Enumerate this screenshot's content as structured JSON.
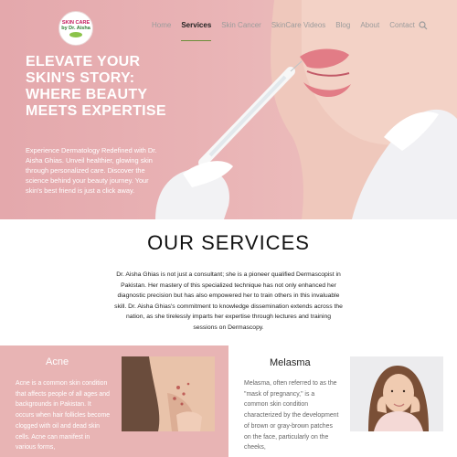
{
  "logo": {
    "line1": "SKIN CARE",
    "line2": "by Dr. Aisha",
    "line3": ""
  },
  "nav": {
    "items": [
      "Home",
      "Services",
      "Skin Cancer",
      "SkinCare Videos",
      "Blog",
      "About",
      "Contact"
    ],
    "active": "Services",
    "search_icon": "search-icon"
  },
  "hero": {
    "title": "ELEVATE YOUR SKIN'S STORY: WHERE BEAUTY MEETS EXPERTISE",
    "text": "Experience Dermatology Redefined with Dr. Aisha Ghias. Unveil healthier, glowing skin through personalized care. Discover the science behind your beauty journey. Your skin's best friend is just a click away."
  },
  "services": {
    "title": "OUR SERVICES",
    "text": "Dr. Aisha Ghias is not just a consultant; she is a pioneer qualified Dermascopist in Pakistan. Her mastery of this specialized technique has not only enhanced her diagnostic precision but has also empowered her to train others in this invaluable skill. Dr. Aisha Ghias's commitment to knowledge dissemination extends across the nation, as she tirelessly imparts her expertise through lectures and training sessions on Dermascopy."
  },
  "cards": {
    "acne": {
      "title": "Acne",
      "text": "Acne is a common skin condition that affects people of all ages and backgrounds in Pakistan. It occurs when hair follicles become clogged with oil and dead skin cells. Acne can manifest in various forms,"
    },
    "melasma": {
      "title": "Melasma",
      "text": "Melasma, often referred to as the \"mask of pregnancy,\" is a common skin condition characterized by the development of brown or gray-brown patches on the face, particularly on the cheeks,"
    }
  },
  "colors": {
    "hero_pink": "#e4a8ac",
    "card_pink": "#e8b4b4",
    "active_underline": "#6b8e3a"
  }
}
